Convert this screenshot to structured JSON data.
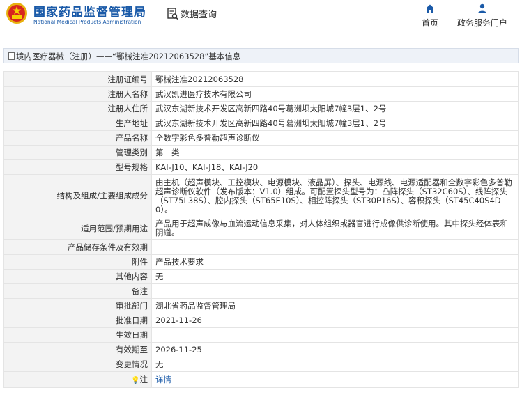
{
  "header": {
    "site_name_cn": "国家药品监督管理局",
    "site_name_en": "National Medical Products Administration",
    "query_label": "数据查询",
    "nav": [
      {
        "label": "首页",
        "icon": "home-icon"
      },
      {
        "label": "政务服务门户",
        "icon": "user-icon"
      }
    ]
  },
  "breadcrumb": "境内医疗器械（注册）——“鄂械注准20212063528”基本信息",
  "fields": [
    {
      "label": "注册证编号",
      "value": "鄂械注准20212063528"
    },
    {
      "label": "注册人名称",
      "value": "武汉凯进医疗技术有限公司"
    },
    {
      "label": "注册人住所",
      "value": "武汉东湖新技术开发区高新四路40号葛洲坝太阳城7幢3层1、2号"
    },
    {
      "label": "生产地址",
      "value": "武汉东湖新技术开发区高新四路40号葛洲坝太阳城7幢3层1、2号"
    },
    {
      "label": "产品名称",
      "value": "全数字彩色多普勒超声诊断仪"
    },
    {
      "label": "管理类别",
      "value": "第二类"
    },
    {
      "label": "型号规格",
      "value": "KAI-J10、KAI-J18、KAI-J20"
    },
    {
      "label": "结构及组成/主要组成成分",
      "value": "由主机（超声模块、工控模块、电源模块、液晶屏）、探头、电源线、电源适配器和全数字彩色多普勒超声诊断仪软件（发布版本：V1.0）组成。可配置探头型号为：凸阵探头（ST32C60S）、线阵探头（ST75L38S）、腔内探头（ST65E10S）、相控阵探头（ST30P16S）、容积探头（ST45C40S4D0）。"
    },
    {
      "label": "适用范围/预期用途",
      "value": "产品用于超声成像与血流运动信息采集，对人体组织或器官进行成像供诊断使用。其中探头经体表和阴道。"
    },
    {
      "label": "产品储存条件及有效期",
      "value": ""
    },
    {
      "label": "附件",
      "value": "产品技术要求"
    },
    {
      "label": "其他内容",
      "value": "无"
    },
    {
      "label": "备注",
      "value": ""
    },
    {
      "label": "审批部门",
      "value": "湖北省药品监督管理局"
    },
    {
      "label": "批准日期",
      "value": "2021-11-26"
    },
    {
      "label": "生效日期",
      "value": ""
    },
    {
      "label": "有效期至",
      "value": "2026-11-25"
    },
    {
      "label": "变更情况",
      "value": "无"
    },
    {
      "label": "注",
      "value": "详情",
      "icon": "lightbulb-icon"
    }
  ],
  "colors": {
    "brand_blue": "#1a5aa8",
    "label_bg": "#f3f3f3",
    "breadcrumb_bg": "#eef2f8"
  }
}
